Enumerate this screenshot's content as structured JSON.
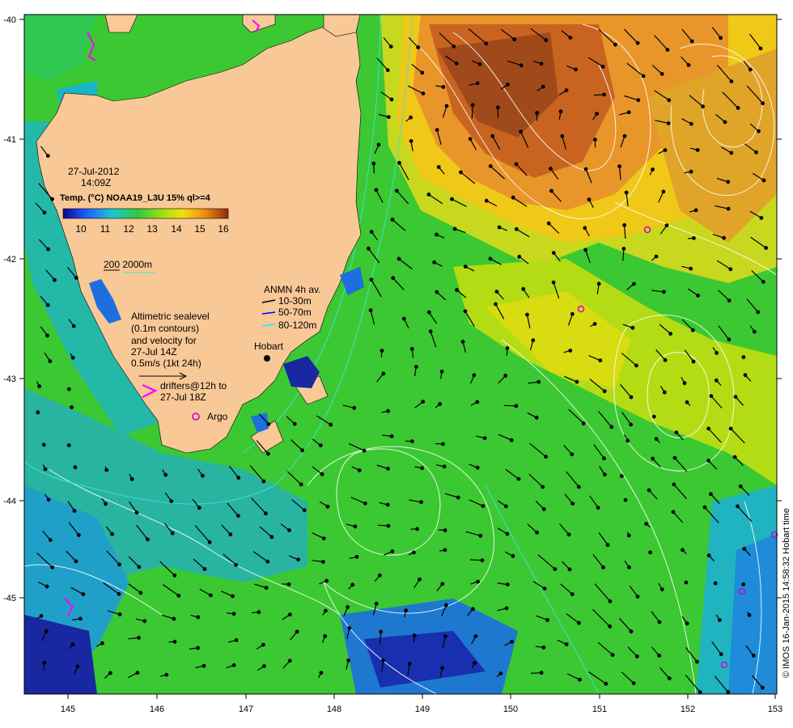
{
  "map": {
    "lon_range": [
      144.5,
      153
    ],
    "lat_range": [
      -45.6,
      -40
    ],
    "x_ticks": [
      "145",
      "146",
      "147",
      "148",
      "149",
      "150",
      "151",
      "152",
      "153"
    ],
    "y_ticks": [
      "-40",
      "-41",
      "-42",
      "-43",
      "-44",
      "-45"
    ],
    "date": "27-Jul-2012",
    "time": "14:09Z",
    "colorbar_title": "Temp. (°C) NOAA19_L3U 15% ql>=4",
    "colorbar_ticks": [
      "10",
      "11",
      "12",
      "13",
      "14",
      "15",
      "16"
    ],
    "colorbar_colors": [
      "#0a0a8c",
      "#1f5fff",
      "#18c8d0",
      "#30c840",
      "#9ee010",
      "#f0e010",
      "#f08c10",
      "#8c2a10"
    ],
    "bathymetry_legend": "200  2000m",
    "anmn": {
      "title": "ANMN 4h av.",
      "items": [
        {
          "label": "10-30m",
          "color": "#000000"
        },
        {
          "label": "50-70m",
          "color": "#0000ff"
        },
        {
          "label": "80-120m",
          "color": "#00ffff"
        }
      ]
    },
    "altimetry_lines": [
      "Altimetric sealevel",
      "(0.1m contours)",
      "and velocity for",
      "27-Jul 14Z",
      "0.5m/s (1kt 24h)"
    ],
    "drifters": [
      "drifters@12h to",
      "27-Jul 18Z"
    ],
    "argo": "Argo",
    "city": "Hobart",
    "credit": "© IMOS 16-Jan-2015 14:58:32 Hobart time",
    "colors": {
      "land": "#f8c896",
      "drifter": "#ff00ff",
      "argo": "#d000d0"
    }
  }
}
